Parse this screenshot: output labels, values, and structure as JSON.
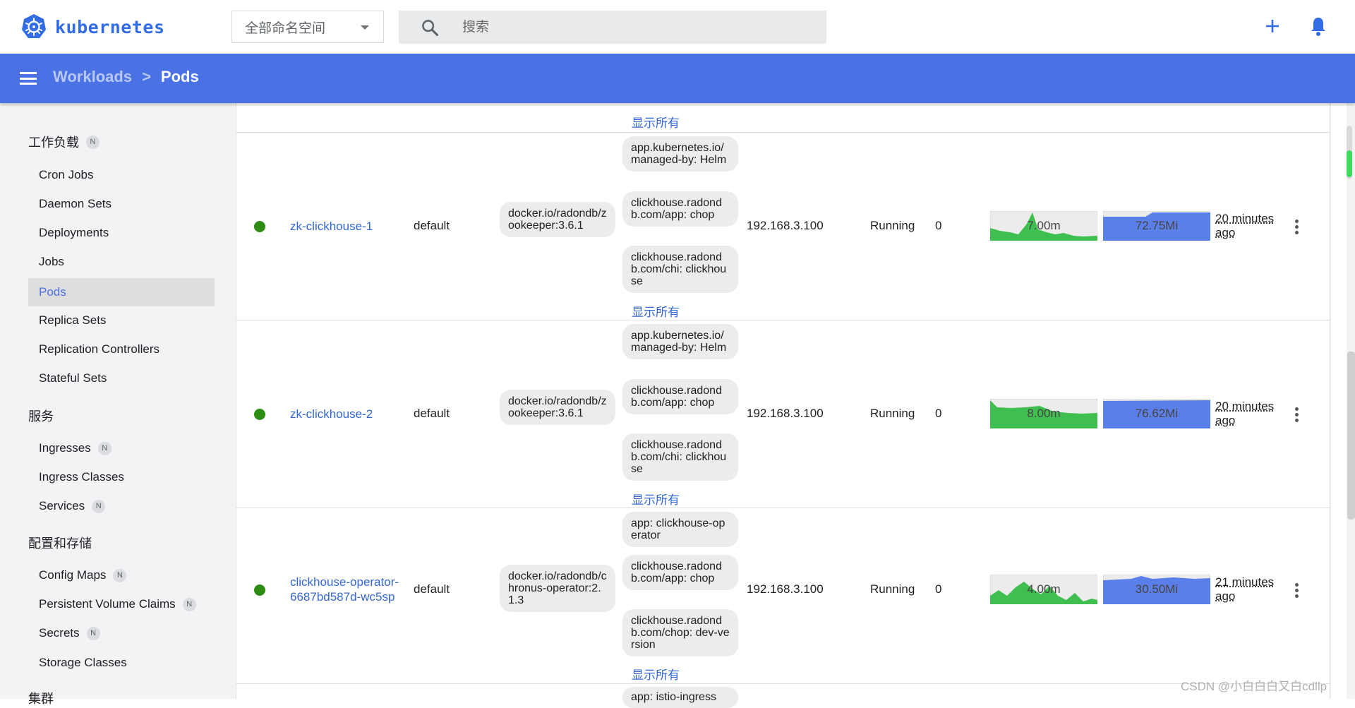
{
  "app": {
    "logo_text": "kubernetes",
    "namespace_select": "全部命名空间",
    "search_placeholder": "搜索"
  },
  "breadcrumb": {
    "parent": "Workloads",
    "separator": ">",
    "current": "Pods"
  },
  "sidebar": {
    "groups": [
      {
        "title": "工作负载",
        "badge": "N"
      },
      {
        "title": "服务"
      },
      {
        "title": "配置和存储"
      },
      {
        "title": "集群"
      }
    ],
    "items": [
      {
        "label": "Cron Jobs"
      },
      {
        "label": "Daemon Sets"
      },
      {
        "label": "Deployments"
      },
      {
        "label": "Jobs"
      },
      {
        "label": "Pods",
        "active": true
      },
      {
        "label": "Replica Sets"
      },
      {
        "label": "Replication Controllers"
      },
      {
        "label": "Stateful Sets"
      },
      {
        "label": "Ingresses",
        "badge": "N"
      },
      {
        "label": "Ingress Classes"
      },
      {
        "label": "Services",
        "badge": "N"
      },
      {
        "label": "Config Maps",
        "badge": "N"
      },
      {
        "label": "Persistent Volume Claims",
        "badge": "N"
      },
      {
        "label": "Secrets",
        "badge": "N"
      },
      {
        "label": "Storage Classes"
      }
    ]
  },
  "table": {
    "show_all_label": "显示所有",
    "partial_top_label": "显示所有",
    "rows": [
      {
        "name": "zk-clickhouse-1",
        "namespace": "default",
        "image": "docker.io/radondb/zookeeper:3.6.1",
        "labels": [
          "app.kubernetes.io/managed-by: Helm",
          "clickhouse.radondb.com/app: chop",
          "clickhouse.radondb.com/chi: clickhouse"
        ],
        "show_all": "显示所有",
        "node": "192.168.3.100",
        "status": "Running",
        "restarts": "0",
        "cpu": "7.00m",
        "memory": "72.75Mi",
        "age_line1": "20 minutes",
        "age_line2": "ago"
      },
      {
        "name": "zk-clickhouse-2",
        "namespace": "default",
        "image": "docker.io/radondb/zookeeper:3.6.1",
        "labels": [
          "app.kubernetes.io/managed-by: Helm",
          "clickhouse.radondb.com/app: chop",
          "clickhouse.radondb.com/chi: clickhouse"
        ],
        "show_all": "显示所有",
        "node": "192.168.3.100",
        "status": "Running",
        "restarts": "0",
        "cpu": "8.00m",
        "memory": "76.62Mi",
        "age_line1": "20 minutes",
        "age_line2": "ago"
      },
      {
        "name": "clickhouse-operator-6687bd587d-wc5sp",
        "namespace": "default",
        "image": "docker.io/radondb/chronus-operator:2.1.3",
        "labels": [
          "app: clickhouse-operator",
          "clickhouse.radondb.com/app: chop",
          "clickhouse.radondb.com/chop: dev-version"
        ],
        "show_all": "显示所有",
        "node": "192.168.3.100",
        "status": "Running",
        "restarts": "0",
        "cpu": "4.00m",
        "memory": "30.50Mi",
        "age_line1": "21 minutes",
        "age_line2": "ago"
      }
    ],
    "partial_bottom_label": "app: istio-ingress"
  },
  "colors": {
    "brand": "#326ce5",
    "bluebar": "#4b72e4",
    "status_running": "#2e8b14",
    "cpu_fill": "#3fbf4f",
    "mem_fill": "#5b7fe8"
  },
  "watermark": "CSDN @小白白白又白cdllp"
}
